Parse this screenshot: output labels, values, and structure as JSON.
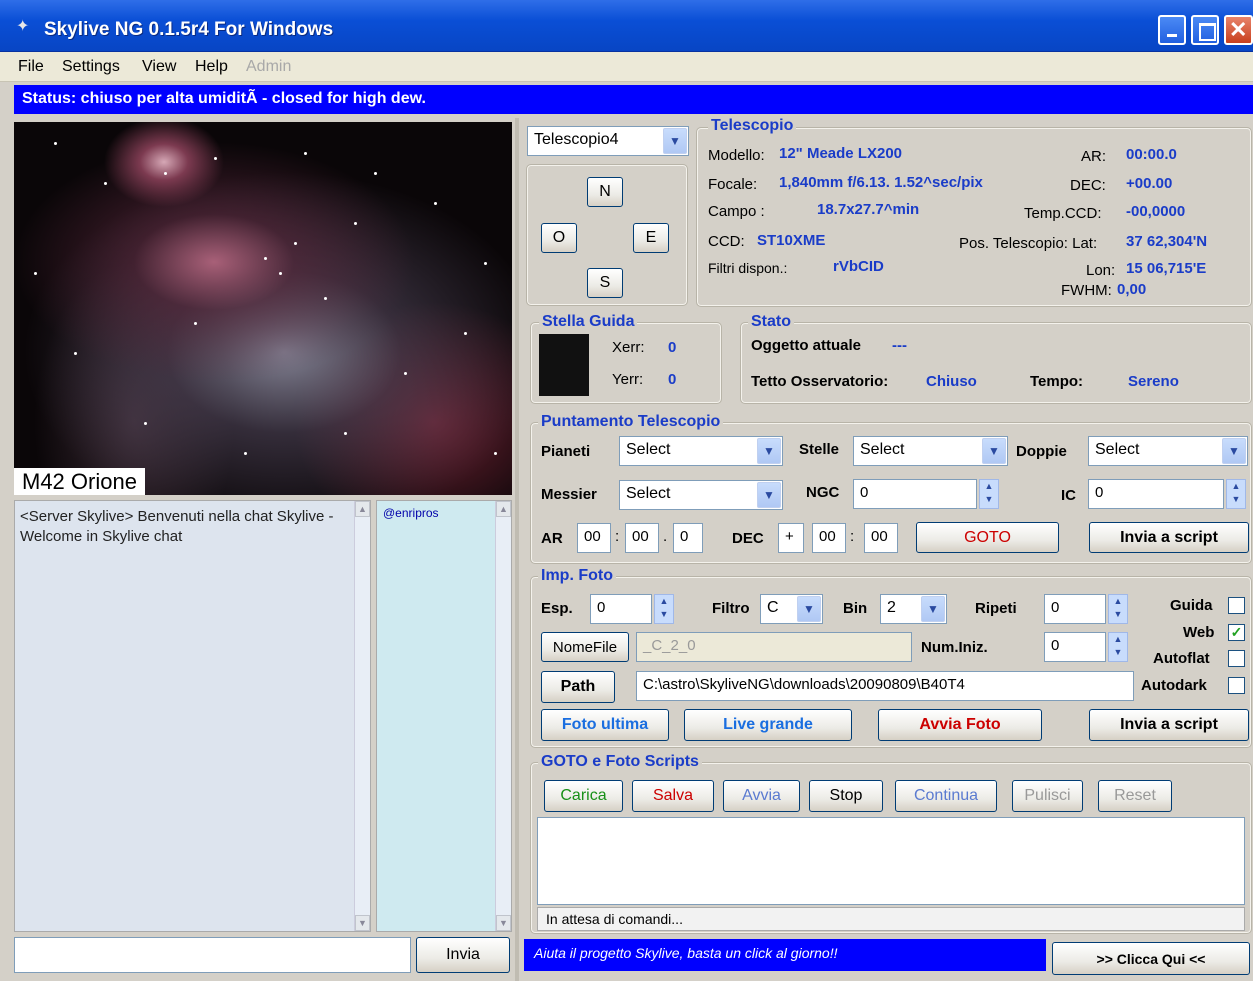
{
  "window": {
    "title": "Skylive NG 0.1.5r4 For Windows"
  },
  "menu": {
    "items": [
      "File",
      "Settings",
      "View",
      "Help"
    ],
    "admin": "Admin"
  },
  "status": "Status: chiuso per alta umiditÃ  - closed for high dew.",
  "image": {
    "caption": "M42 Orione"
  },
  "chat": {
    "text": "<Server Skylive> Benvenuti nella chat Skylive - Welcome in Skylive chat",
    "users": [
      "@enripros"
    ],
    "input_value": "",
    "send_label": "Invia"
  },
  "telescope": {
    "selected": "Telescopio4",
    "directions": {
      "north": "N",
      "west": "O",
      "east": "E",
      "south": "S"
    },
    "group_title": "Telescopio",
    "model_label": "Modello:",
    "model_value": "12\" Meade LX200",
    "focal_label": "Focale:",
    "focal_value": "1,840mm f/6.13. 1.52^sec/pix",
    "field_label": "Campo  :",
    "field_value": "18.7x27.7^min",
    "ccd_label": "CCD:",
    "ccd_value": "ST10XME",
    "filters_label": "Filtri dispon.:",
    "filters_value": "rVbCID",
    "ar_label": "AR:",
    "ar_value": "00:00.0",
    "dec_label": "DEC:",
    "dec_value": "+00.00",
    "temp_label": "Temp.CCD:",
    "temp_value": "-00,0000",
    "lat_label": "Pos. Telescopio: Lat:",
    "lat_value": "37 62,304'N",
    "lon_label": "Lon:",
    "lon_value": "15 06,715'E",
    "fwhm_label": "FWHM:",
    "fwhm_value": "0,00"
  },
  "guide": {
    "title": "Stella Guida",
    "xerr_label": "Xerr:",
    "xerr": "0",
    "yerr_label": "Yerr:",
    "yerr": "0"
  },
  "state": {
    "title": "Stato",
    "object_label": "Oggetto attuale",
    "object_value": "---",
    "roof_label": "Tetto Osservatorio:",
    "roof_value": "Chiuso",
    "weather_label": "Tempo:",
    "weather_value": "Sereno"
  },
  "pointing": {
    "title": "Puntamento Telescopio",
    "planets_label": "Pianeti",
    "planets_value": "Select",
    "stars_label": "Stelle",
    "stars_value": "Select",
    "doubles_label": "Doppie",
    "doubles_value": "Select",
    "messier_label": "Messier",
    "messier_value": "Select",
    "ngc_label": "NGC",
    "ngc_value": "0",
    "ic_label": "IC",
    "ic_value": "0",
    "ar_label": "AR",
    "ar_h": "00",
    "ar_m": "00",
    "ar_s": "0",
    "dec_label": "DEC",
    "dec_sign": "+",
    "dec_d": "00",
    "dec_m": "00",
    "goto_label": "GOTO",
    "script_label": "Invia a script"
  },
  "photo": {
    "title": "Imp. Foto",
    "exp_label": "Esp.",
    "exp_value": "0",
    "filter_label": "Filtro",
    "filter_value": "C",
    "bin_label": "Bin",
    "bin_value": "2",
    "repeat_label": "Ripeti",
    "repeat_value": "0",
    "guide_label": "Guida",
    "guide_checked": false,
    "web_label": "Web",
    "web_checked": true,
    "filename_button": "NomeFile",
    "filename_value": "_C_2_0",
    "start_num_label": "Num.Iniz.",
    "start_num_value": "0",
    "autoflat_label": "Autoflat",
    "autoflat_checked": false,
    "path_button": "Path",
    "path_value": "C:\\astro\\SkyliveNG\\downloads\\20090809\\B40T4",
    "autodark_label": "Autodark",
    "autodark_checked": false,
    "last_photo_label": "Foto ultima",
    "live_large_label": "Live grande",
    "start_photo_label": "Avvia Foto",
    "script_label": "Invia a script"
  },
  "scripts": {
    "title": "GOTO e Foto Scripts",
    "load": "Carica",
    "save": "Salva",
    "run": "Avvia",
    "stop": "Stop",
    "continue": "Continua",
    "clear": "Pulisci",
    "reset": "Reset",
    "status": "In attesa di comandi..."
  },
  "footer": {
    "banner": "Aiuta il progetto Skylive, basta un click al giorno!!",
    "button": ">> Clicca Qui <<"
  },
  "colors": {
    "titlebar": "#0a4fd6",
    "status_bg": "#0000ff",
    "accent_blue": "#1a3cc8",
    "goto_red": "#cc0000",
    "chat_users_bg": "#cfeaf0"
  }
}
